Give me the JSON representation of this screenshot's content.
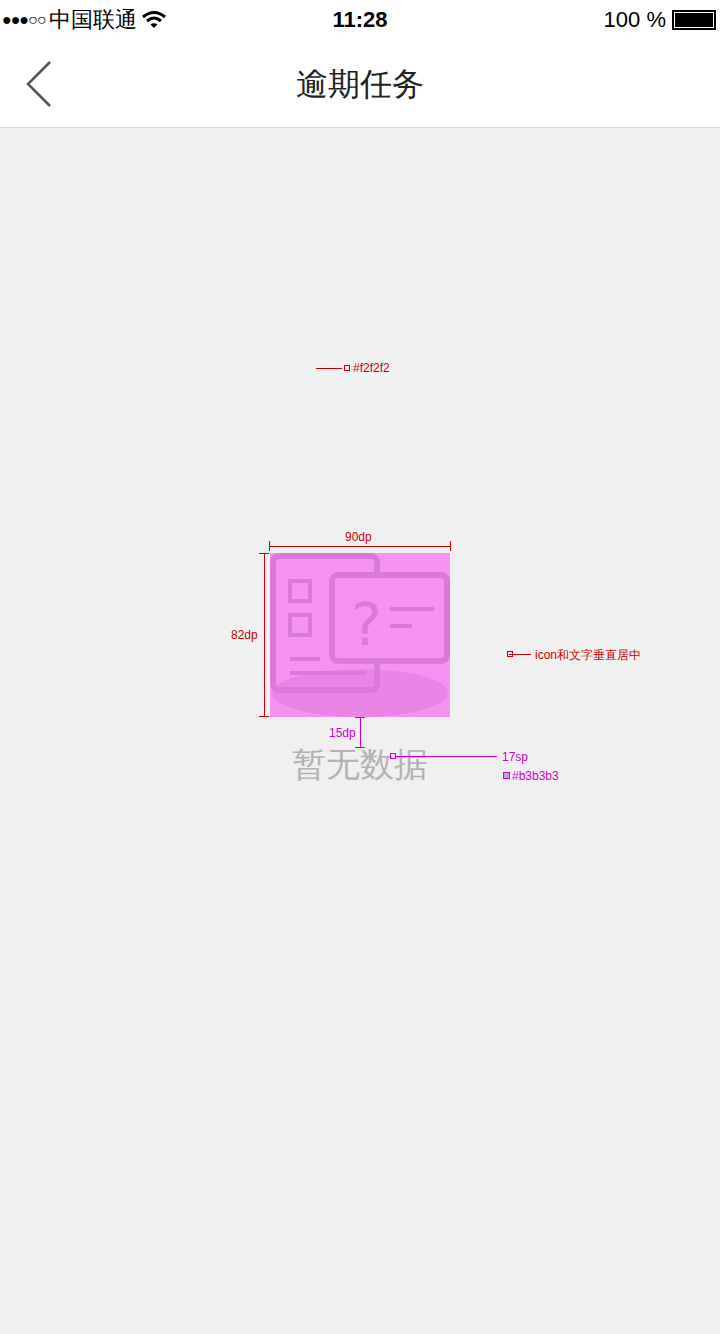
{
  "status_bar": {
    "signal": "●●●○○",
    "carrier": "中国联通",
    "time": "11:28",
    "battery": "100 %",
    "battery_level": 1
  },
  "nav": {
    "title": "逾期任务"
  },
  "empty_state": {
    "icon_glyph": "?",
    "message": "暂无数据"
  },
  "annotations": {
    "background_note": "#f2f2f2",
    "icon_width": "90dp",
    "icon_height": "82dp",
    "spacing": "15dp",
    "alignment_note": "icon和文字垂直居中",
    "text_size": "17sp",
    "text_color": "#b3b3b3"
  }
}
